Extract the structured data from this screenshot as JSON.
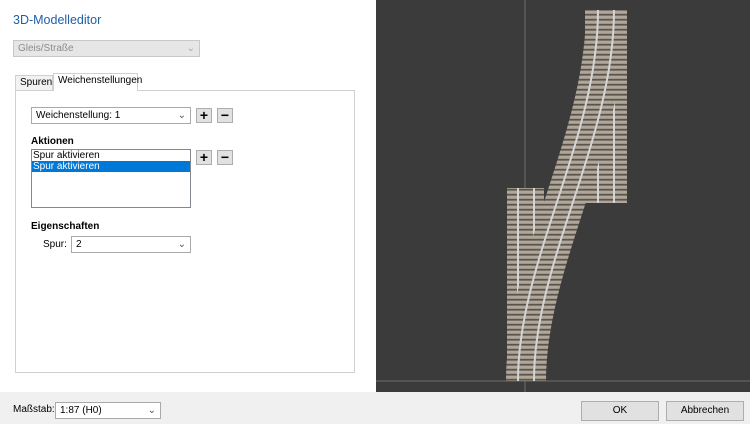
{
  "window": {
    "title": "3D-Modelleditor"
  },
  "type_select": {
    "value": "Gleis/Straße"
  },
  "tabs": [
    {
      "label": "Spuren"
    },
    {
      "label": "Weichenstellungen"
    }
  ],
  "switch_setting": {
    "value": "Weichenstellung: 1",
    "add_symbol": "+",
    "remove_symbol": "−"
  },
  "actions": {
    "heading": "Aktionen",
    "items": [
      {
        "label": "Spur aktivieren"
      },
      {
        "label": "Spur aktivieren"
      }
    ],
    "add_symbol": "+",
    "remove_symbol": "−"
  },
  "properties": {
    "heading": "Eigenschaften",
    "track_label": "Spur:",
    "track_value": "2"
  },
  "footer": {
    "scale_label": "Maßstab:",
    "scale_value": "1:87 (H0)",
    "ok_label": "OK",
    "cancel_label": "Abbrechen"
  },
  "icons": {
    "dropdown": "chevron-down-icon"
  },
  "colors": {
    "accent": "#1f5fa8",
    "selection": "#0078d7",
    "viewport_bg": "#3b3b3b"
  }
}
